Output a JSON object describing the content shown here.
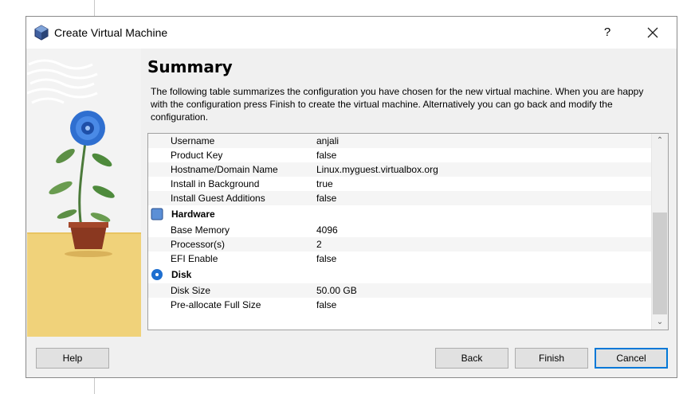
{
  "window": {
    "title": "Create Virtual Machine",
    "help_glyph": "?"
  },
  "page": {
    "heading": "Summary",
    "intro": "The following table summarizes the configuration you have chosen for the new virtual machine. When you are happy with the configuration press Finish to create the virtual machine. Alternatively you can go back and modify the configuration."
  },
  "summary": {
    "rows_top": [
      {
        "key": "Username",
        "value": "anjali"
      },
      {
        "key": "Product Key",
        "value": "false"
      },
      {
        "key": "Hostname/Domain Name",
        "value": "Linux.myguest.virtualbox.org"
      },
      {
        "key": "Install in Background",
        "value": "true"
      },
      {
        "key": "Install Guest Additions",
        "value": "false"
      }
    ],
    "hardware": {
      "label": "Hardware",
      "rows": [
        {
          "key": "Base Memory",
          "value": "4096"
        },
        {
          "key": "Processor(s)",
          "value": "2"
        },
        {
          "key": "EFI Enable",
          "value": "false"
        }
      ]
    },
    "disk": {
      "label": "Disk",
      "rows": [
        {
          "key": "Disk Size",
          "value": "50.00 GB"
        },
        {
          "key": "Pre-allocate Full Size",
          "value": "false"
        }
      ]
    }
  },
  "buttons": {
    "help": "Help",
    "back": "Back",
    "finish": "Finish",
    "cancel": "Cancel"
  },
  "colors": {
    "accent": "#0078d7",
    "hardware_icon": "#5b8fd6",
    "disk_icon": "#1e6fd0",
    "art_yellow": "#f0d27a"
  }
}
